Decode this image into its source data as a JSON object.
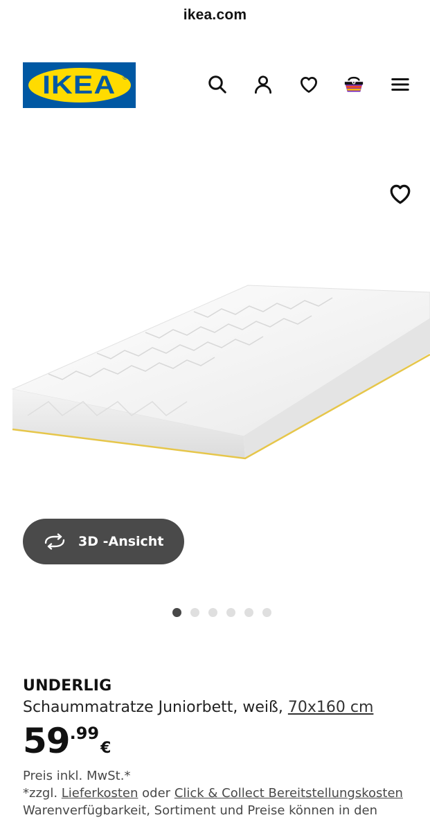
{
  "browser": {
    "url": "ikea.com"
  },
  "header": {
    "logo_text": "IKEA",
    "logo_reg": "®",
    "icons": [
      "search-icon",
      "user-icon",
      "heart-icon",
      "shopping-bag-icon",
      "menu-icon"
    ]
  },
  "gallery": {
    "view3d_label": "3D -Ansicht",
    "slides_total": 6,
    "active_slide": 1
  },
  "product": {
    "brand": "UNDERLIG",
    "description": "Schaummatratze Juniorbett, weiß,",
    "size": "70x160 cm",
    "price_int": "59",
    "price_dec": ".99",
    "currency": "€",
    "vat_note": "Preis inkl. MwSt.*",
    "shipping_prefix": "*zzgl.",
    "shipping_link": "Lieferkosten",
    "shipping_or": "oder",
    "click_collect_link": "Click & Collect Bereitstellungskosten",
    "availability_note": "Warenverfügbarkeit, Sortiment und Preise können in den"
  },
  "colors": {
    "ikea_blue": "#0058a3",
    "ikea_yellow": "#ffdb00",
    "pill_bg": "#4a4a4a",
    "dot_active": "#484848",
    "dot_inactive": "#dfdfdf"
  }
}
